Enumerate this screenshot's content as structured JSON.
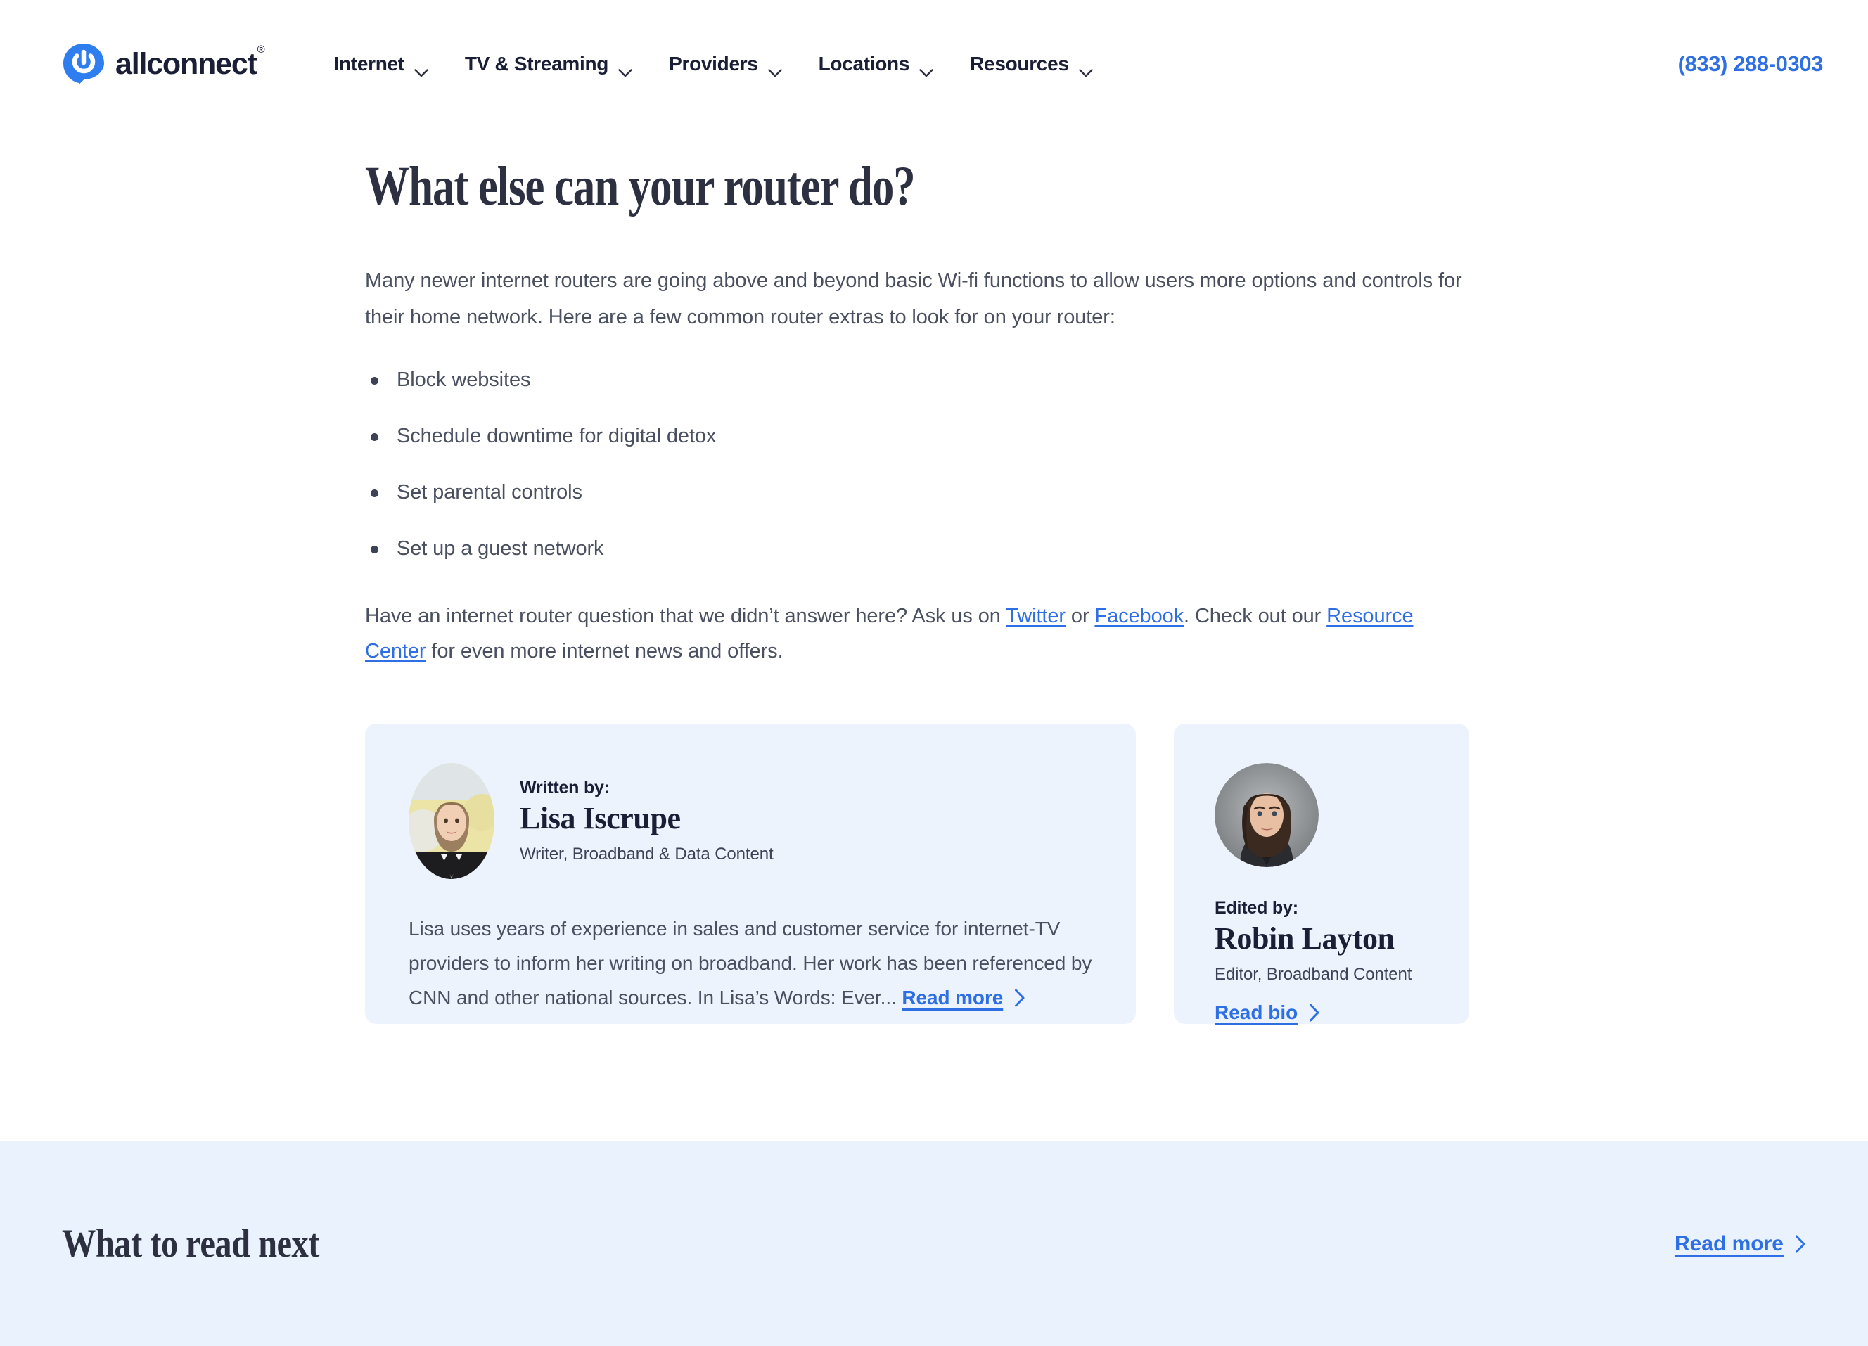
{
  "header": {
    "brand": {
      "name": "allconnect",
      "registered": "®",
      "icon": "power-logo-icon"
    },
    "nav": [
      {
        "label": "Internet",
        "icon": "chevron-down-icon"
      },
      {
        "label": "TV & Streaming",
        "icon": "chevron-down-icon"
      },
      {
        "label": "Providers",
        "icon": "chevron-down-icon"
      },
      {
        "label": "Locations",
        "icon": "chevron-down-icon"
      },
      {
        "label": "Resources",
        "icon": "chevron-down-icon"
      }
    ],
    "phone": "(833) 288-0303"
  },
  "article": {
    "title": "What else can your router do?",
    "intro": "Many newer internet routers are going above and beyond basic Wi-fi functions to allow users more options and controls for their home network. Here are a few common router extras to look for on your router:",
    "bullets": [
      "Block websites",
      "Schedule downtime for digital detox",
      "Set parental controls",
      "Set up a guest network"
    ],
    "closing": {
      "part1": "Have an internet router question that we didn’t answer here? Ask us on ",
      "link_twitter": "Twitter",
      "part2": " or ",
      "link_facebook": "Facebook",
      "part3": ". Check out our ",
      "link_resource_center": "Resource Center",
      "part4": " for even more internet news and offers."
    }
  },
  "author_card": {
    "byline_label": "Written by:",
    "name": "Lisa Iscrupe",
    "role": "Writer, Broadband & Data Content",
    "bio": "Lisa uses years of experience in sales and customer service for internet-TV providers to inform her writing on broadband. Her work has been referenced by CNN and other national sources. In Lisa’s Words: Ever... ",
    "read_more": "Read more",
    "chevron": "chevron-right-icon",
    "avatar": "avatar-lisa-iscrupe"
  },
  "editor_card": {
    "byline_label": "Edited by:",
    "name": "Robin Layton",
    "role": "Editor, Broadband Content",
    "read_bio": "Read bio",
    "chevron": "chevron-right-icon",
    "avatar": "avatar-robin-layton"
  },
  "read_next": {
    "title": "What to read next",
    "link": "Read more",
    "chevron": "chevron-right-icon"
  },
  "colors": {
    "accent_blue": "#2f6fe4",
    "card_bg": "#ecf3fd",
    "band_bg": "#eaf2fd",
    "heading": "#2c3040",
    "body_text": "#4a5060"
  }
}
